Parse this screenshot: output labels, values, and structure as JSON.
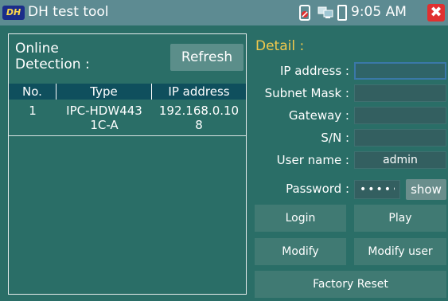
{
  "titlebar": {
    "logo": "DH",
    "title": "DH test tool",
    "time": "9:05 AM",
    "close": "✖"
  },
  "online": {
    "title_line1": "Online",
    "title_line2": "Detection :",
    "refresh_label": "Refresh",
    "columns": [
      "No.",
      "Type",
      "IP address"
    ],
    "rows": [
      {
        "no": "1",
        "type": "IPC-HDW4431C-A",
        "ip": "192.168.0.108"
      }
    ]
  },
  "detail": {
    "title": "Detail :",
    "fields": {
      "ip_label": "IP address :",
      "ip_value": "",
      "mask_label": "Subnet Mask :",
      "mask_value": "",
      "gateway_label": "Gateway :",
      "gateway_value": "",
      "sn_label": "S/N :",
      "sn_value": "",
      "user_label": "User name :",
      "user_value": "admin",
      "password_label": "Password :",
      "password_value": "•••••"
    },
    "show_label": "show",
    "buttons": {
      "login": "Login",
      "play": "Play",
      "modify": "Modify",
      "modify_user": "Modify user",
      "factory_reset": "Factory Reset"
    }
  }
}
